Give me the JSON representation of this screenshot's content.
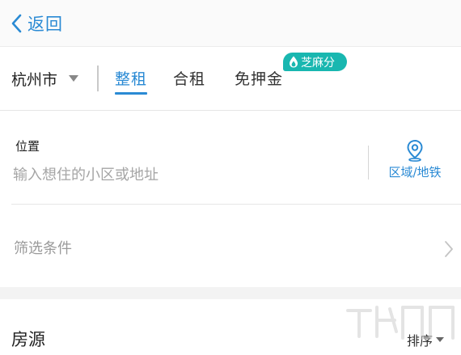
{
  "nav": {
    "back_label": "返回"
  },
  "city": {
    "label": "杭州市"
  },
  "tabs": [
    {
      "label": "整租",
      "active": true
    },
    {
      "label": "合租",
      "active": false
    },
    {
      "label": "免押金",
      "active": false
    }
  ],
  "badge": {
    "label": "芝麻分",
    "color": "#19b7b0"
  },
  "location": {
    "label": "位置",
    "placeholder": "输入想住的小区或地址",
    "area_button_label": "区域/地铁"
  },
  "filter": {
    "label": "筛选条件"
  },
  "listing": {
    "title": "房源",
    "sort_label": "排序"
  },
  "colors": {
    "accent": "#2a8ad4",
    "badge": "#19b7b0",
    "placeholder": "#a5a5a5"
  },
  "icons": [
    "chevron-left-icon",
    "caret-down-icon",
    "flame-icon",
    "location-pin-icon",
    "chevron-right-icon",
    "watermark-logo"
  ]
}
